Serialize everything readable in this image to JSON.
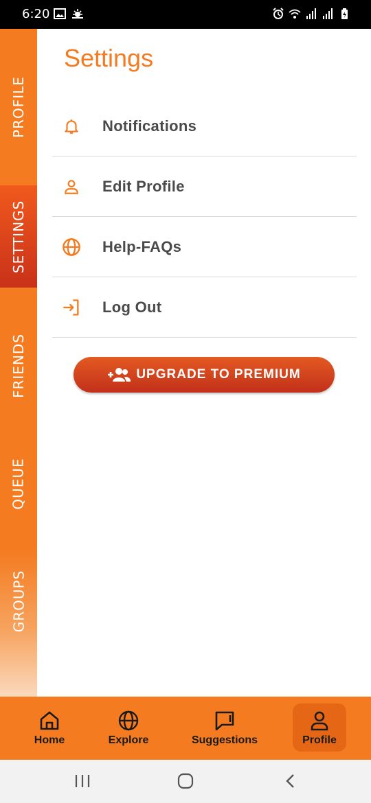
{
  "status_bar": {
    "time": "6:20",
    "left_icons": [
      "image-icon",
      "weather-icon"
    ],
    "right_icons": [
      "alarm-icon",
      "wifi-icon",
      "signal-icon",
      "signal-icon",
      "battery-icon"
    ]
  },
  "side_rail": {
    "tabs": [
      {
        "label": "PROFILE",
        "active": false
      },
      {
        "label": "SETTINGS",
        "active": true
      },
      {
        "label": "FRIENDS",
        "active": false
      },
      {
        "label": "QUEUE",
        "active": false
      },
      {
        "label": "GROUPS",
        "active": false
      }
    ]
  },
  "page": {
    "title": "Settings"
  },
  "menu": {
    "items": [
      {
        "label": "Notifications",
        "icon": "bell-icon"
      },
      {
        "label": "Edit Profile",
        "icon": "person-icon"
      },
      {
        "label": "Help-FAQs",
        "icon": "globe-icon"
      },
      {
        "label": "Log Out",
        "icon": "logout-icon"
      }
    ]
  },
  "premium_button": {
    "label": "UPGRADE TO PREMIUM",
    "icon": "add-group-icon"
  },
  "bottom_nav": {
    "items": [
      {
        "label": "Home",
        "icon": "home-icon",
        "active": false
      },
      {
        "label": "Explore",
        "icon": "globe-icon",
        "active": false
      },
      {
        "label": "Suggestions",
        "icon": "chat-icon",
        "active": false
      },
      {
        "label": "Profile",
        "icon": "person-icon",
        "active": true
      }
    ]
  },
  "system_nav": [
    "recents-icon",
    "home-circle-icon",
    "back-icon"
  ],
  "colors": {
    "accent": "#f47b20",
    "accent_dark": "#c9311a",
    "menu_text": "#4a4a4a"
  }
}
